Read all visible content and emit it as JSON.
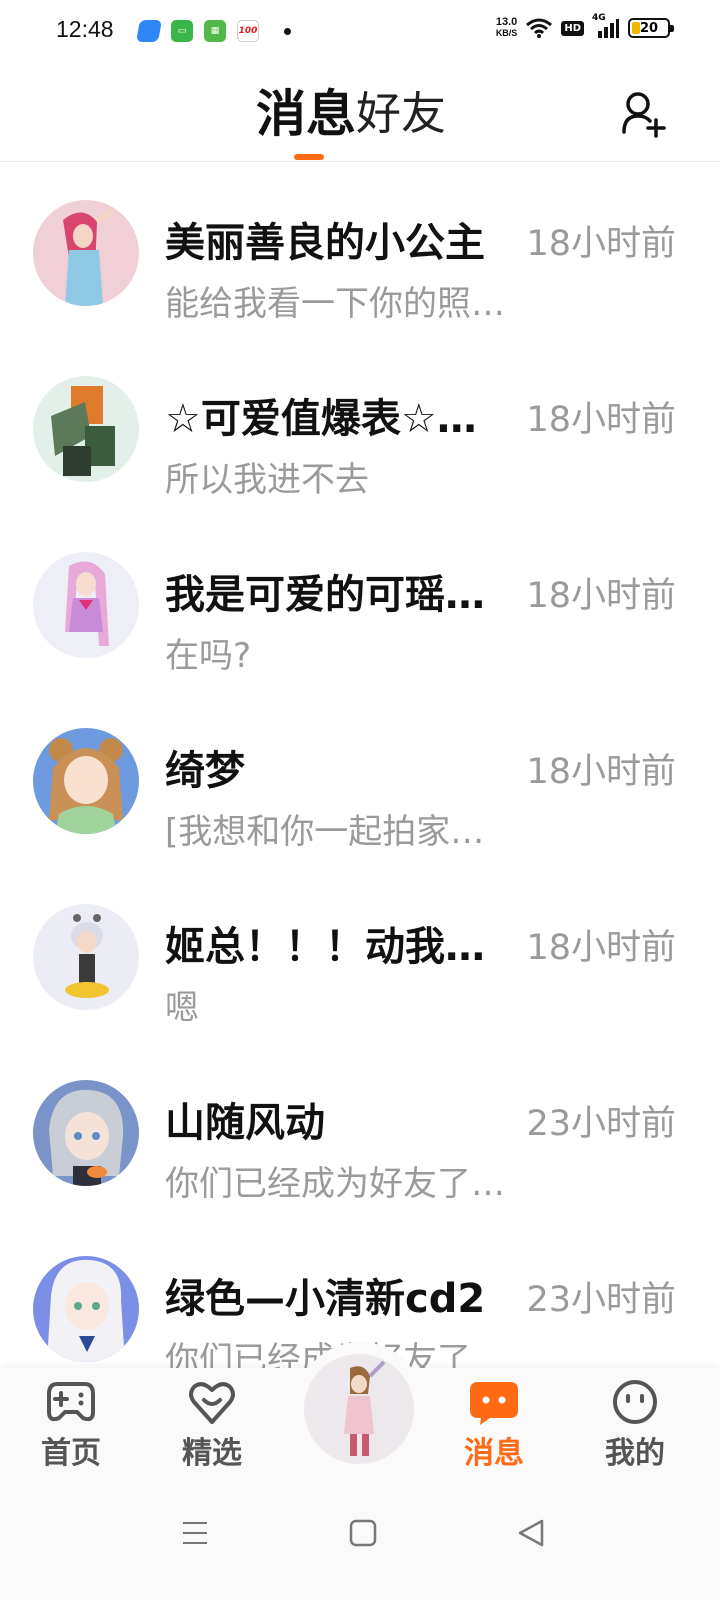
{
  "status_bar": {
    "time": "12:48",
    "speed_value": "13.0",
    "speed_unit": "KB/S",
    "hd": "HD",
    "network": "4G",
    "battery": "20",
    "app_icons": [
      "blue-app-icon",
      "green-chat-icon",
      "green-store-icon",
      "score-100-icon"
    ]
  },
  "header": {
    "tab_messages": "消息",
    "tab_friends": "好友",
    "accent_color": "#ff6a13"
  },
  "conversations": [
    {
      "name": "美丽善良的小公主",
      "time": "18小时前",
      "message": "能给我看一下你的照片吗"
    },
    {
      "name": "☆可爱值爆表☆…",
      "time": "18小时前",
      "message": "所以我进不去"
    },
    {
      "name": "我是可爱的可瑶…",
      "time": "18小时前",
      "message": "在吗?"
    },
    {
      "name": "绮梦",
      "time": "18小时前",
      "message": "[我想和你一起拍家…"
    },
    {
      "name": "姬总！！！动我…",
      "time": "18小时前",
      "message": "嗯"
    },
    {
      "name": "山随风动",
      "time": "23小时前",
      "message": "你们已经成为好友了…"
    },
    {
      "name": "绿色—小清新cd2",
      "time": "23小时前",
      "message": "你们已经成为好友了"
    }
  ],
  "bottom_nav": {
    "home": "首页",
    "featured": "精选",
    "messages": "消息",
    "mine": "我的"
  }
}
